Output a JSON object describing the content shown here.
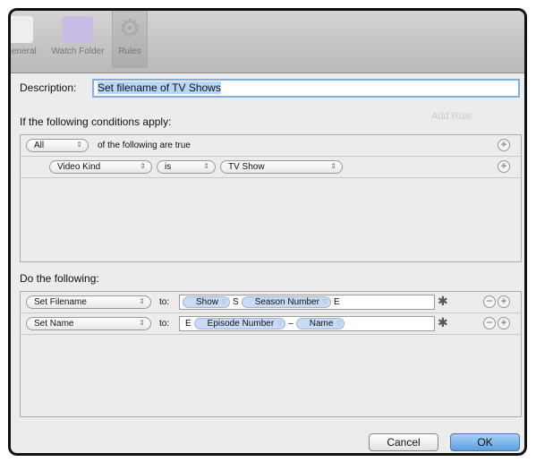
{
  "toolbar": {
    "items": [
      {
        "label": "General"
      },
      {
        "label": "Watch Folder"
      },
      {
        "label": "Rules"
      }
    ]
  },
  "background": {
    "add_rule": "Add Rule"
  },
  "description": {
    "label": "Description:",
    "value": "Set filename of TV Shows"
  },
  "conditions": {
    "heading": "If the following conditions apply:",
    "match": "All",
    "match_suffix": "of the following are true",
    "rule": {
      "field": "Video Kind",
      "operator": "is",
      "value": "TV Show"
    }
  },
  "actions": {
    "heading": "Do the following:",
    "rows": [
      {
        "action": "Set Filename",
        "to": "to:",
        "tokens": [
          {
            "type": "token",
            "text": "Show"
          },
          {
            "type": "text",
            "text": "S"
          },
          {
            "type": "token",
            "text": "Season Number"
          },
          {
            "type": "text",
            "text": "E"
          }
        ]
      },
      {
        "action": "Set Name",
        "to": "to:",
        "tokens": [
          {
            "type": "text",
            "text": "E"
          },
          {
            "type": "token",
            "text": "Episode Number"
          },
          {
            "type": "text",
            "text": "–"
          },
          {
            "type": "token",
            "text": "Name"
          }
        ]
      }
    ]
  },
  "buttons": {
    "cancel": "Cancel",
    "ok": "OK"
  }
}
